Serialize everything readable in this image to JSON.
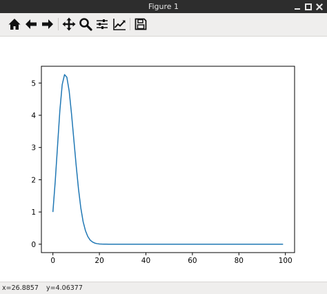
{
  "window": {
    "title": "Figure 1"
  },
  "toolbar": {
    "buttons": [
      {
        "name": "home",
        "icon": "home-icon"
      },
      {
        "name": "back",
        "icon": "arrow-left-icon"
      },
      {
        "name": "forward",
        "icon": "arrow-right-icon"
      },
      {
        "name": "pan",
        "icon": "move-icon"
      },
      {
        "name": "zoom",
        "icon": "magnifier-icon"
      },
      {
        "name": "configure-subplots",
        "icon": "sliders-icon"
      },
      {
        "name": "edit-axis",
        "icon": "line-chart-icon"
      },
      {
        "name": "save",
        "icon": "floppy-disk-icon"
      }
    ]
  },
  "status": {
    "x": "x=26.8857",
    "y": "y=4.06377"
  },
  "chart_data": {
    "type": "line",
    "title": "",
    "xlabel": "",
    "ylabel": "",
    "xlim": [
      -4.95,
      103.95
    ],
    "ylim": [
      -0.26,
      5.52
    ],
    "xticks": [
      "0",
      "20",
      "40",
      "60",
      "80",
      "100"
    ],
    "yticks": [
      "0",
      "1",
      "2",
      "3",
      "4",
      "5"
    ],
    "grid": false,
    "series": [
      {
        "color": "#1f77b4",
        "x": [
          0,
          1,
          2,
          3,
          4,
          5,
          6,
          7,
          8,
          9,
          10,
          11,
          12,
          13,
          14,
          15,
          16,
          17,
          18,
          19,
          20,
          21,
          22,
          23,
          24,
          25,
          26,
          27,
          28,
          29,
          30,
          35,
          40,
          45,
          50,
          55,
          60,
          65,
          70,
          75,
          80,
          85,
          90,
          95,
          99
        ],
        "y": [
          1.0,
          1.95,
          3.05,
          4.15,
          4.95,
          5.26,
          5.18,
          4.75,
          4.05,
          3.25,
          2.45,
          1.72,
          1.13,
          0.7,
          0.42,
          0.24,
          0.13,
          0.07,
          0.035,
          0.017,
          0.008,
          0.004,
          0.002,
          0.001,
          0.0005,
          0.0002,
          0.0001,
          0,
          0,
          0,
          0,
          0,
          0,
          0,
          0,
          0,
          0,
          0,
          0,
          0,
          0,
          0,
          0,
          0,
          0
        ]
      }
    ]
  }
}
